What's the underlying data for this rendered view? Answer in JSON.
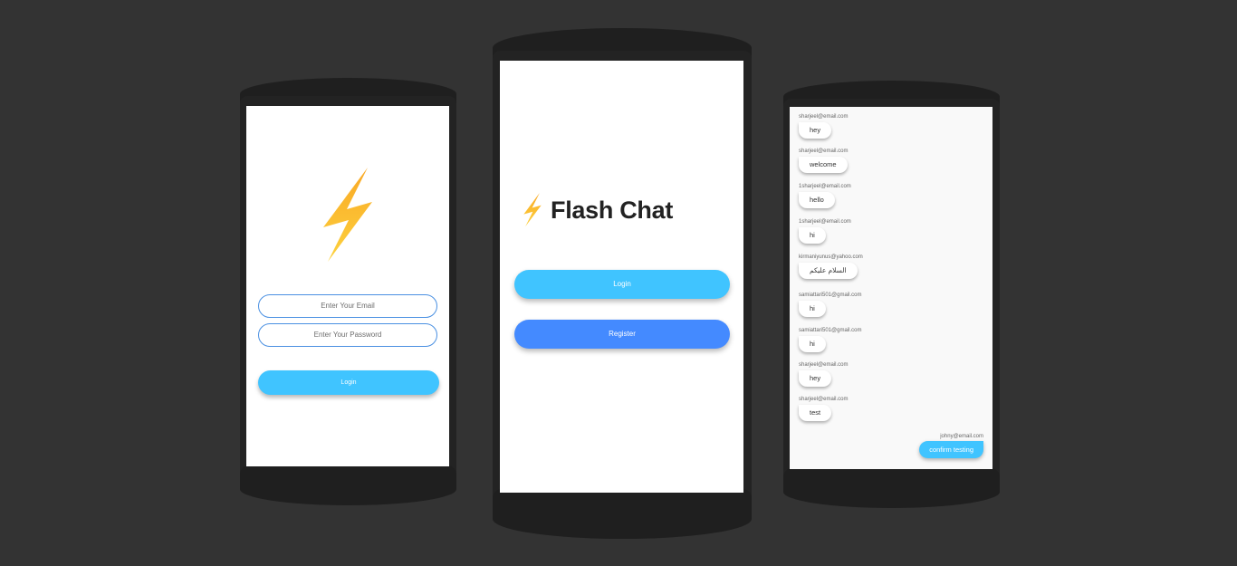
{
  "colors": {
    "background": "#333333",
    "accent": "#40c4ff",
    "register": "#448aff",
    "field_border": "#4a90e2",
    "bolt": "#fbbc1c"
  },
  "login_screen": {
    "logo_icon": "lightning-bolt",
    "email_placeholder": "Enter Your Email",
    "password_placeholder": "Enter Your Password",
    "login_label": "Login"
  },
  "welcome_screen": {
    "logo_icon": "lightning-bolt",
    "title": "Flash Chat",
    "login_label": "Login",
    "register_label": "Register"
  },
  "chat_screen": {
    "messages": [
      {
        "sender": "sharjeel@email.com",
        "text": "hey"
      },
      {
        "sender": "sharjeel@email.com",
        "text": "welcome"
      },
      {
        "sender": "1sharjeel@email.com",
        "text": "hello"
      },
      {
        "sender": "1sharjeel@email.com",
        "text": "hi"
      },
      {
        "sender": "kirmaniyunus@yahoo.com",
        "text": "السلام عليكم"
      },
      {
        "sender": "samiattari501@gmail.com",
        "text": "hi"
      },
      {
        "sender": "samiattari501@gmail.com",
        "text": "hi"
      },
      {
        "sender": "sharjeel@email.com",
        "text": "hey"
      },
      {
        "sender": "sharjeel@email.com",
        "text": "test"
      }
    ],
    "my_message": {
      "sender": "johny@email.com",
      "text": "confirm testing"
    }
  }
}
